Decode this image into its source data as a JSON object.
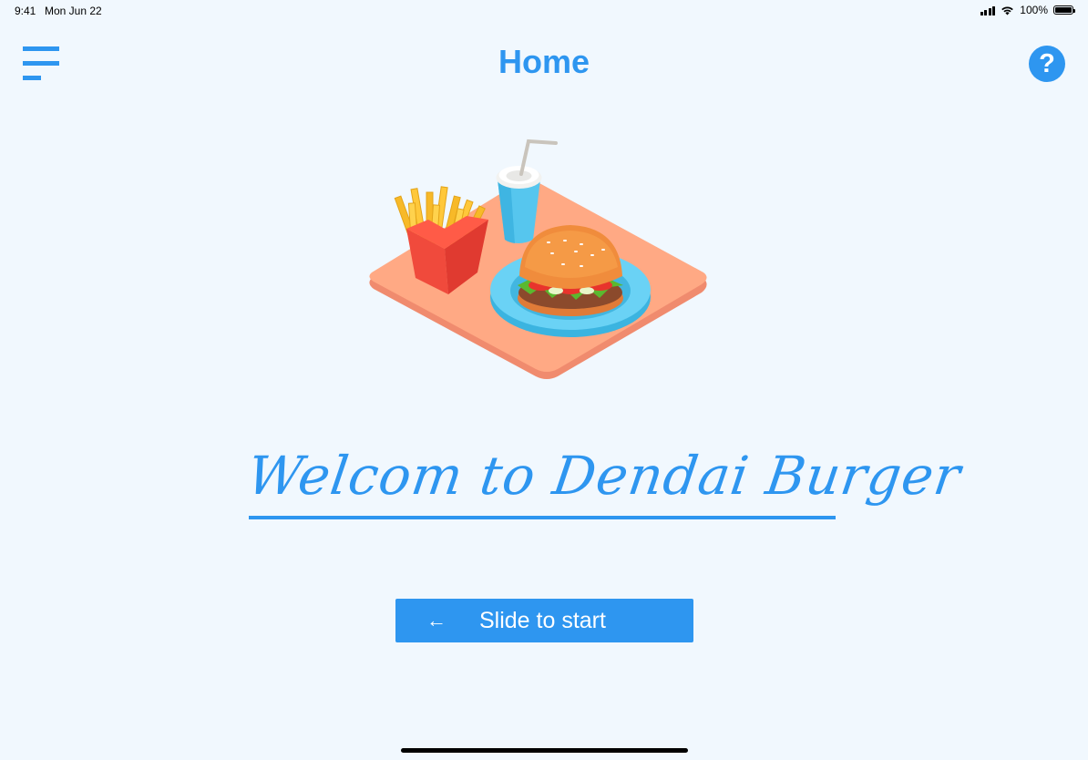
{
  "status_bar": {
    "time": "9:41",
    "date": "Mon Jun 22",
    "battery": "100%"
  },
  "header": {
    "title": "Home",
    "menu_icon": "hamburger-menu-icon",
    "help_icon": "question-mark-icon",
    "help_symbol": "?"
  },
  "hero": {
    "illustration": "burger-fries-drink-tray-illustration"
  },
  "welcome": {
    "text": "Welcom to Dendai Burger"
  },
  "slide_button": {
    "arrow": "←",
    "label": "Slide to start"
  },
  "colors": {
    "accent": "#2e96f0",
    "background": "#f1f8fe"
  }
}
